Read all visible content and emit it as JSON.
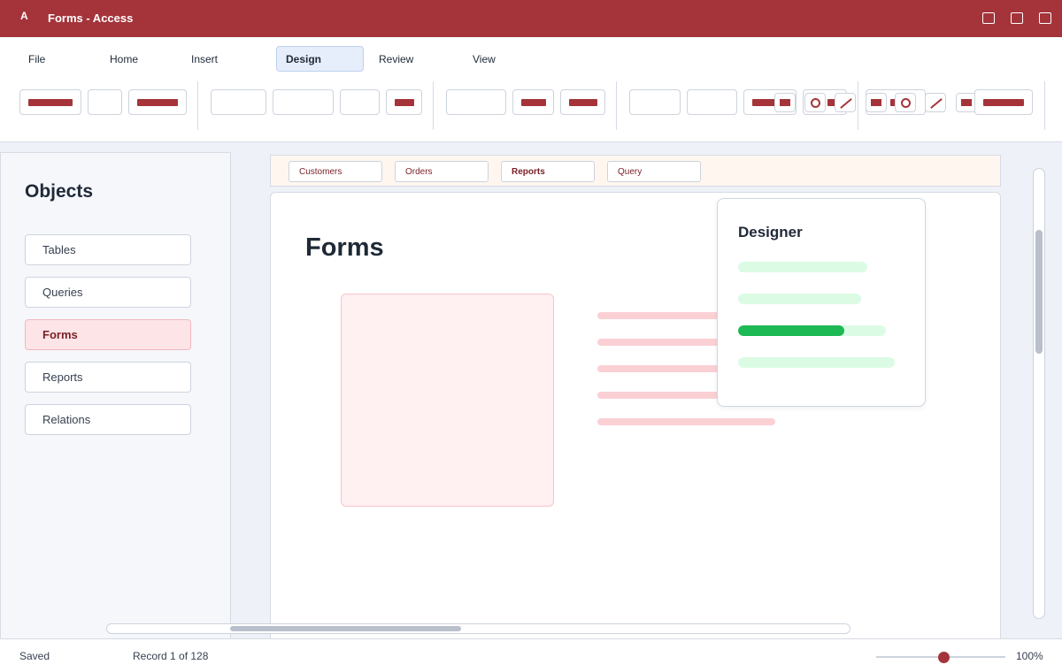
{
  "app": {
    "logo": "A",
    "title": "Forms - Access"
  },
  "ribbon": {
    "tabs": [
      {
        "label": "File"
      },
      {
        "label": "Home"
      },
      {
        "label": "Insert"
      },
      {
        "label": "Design",
        "active": true
      },
      {
        "label": "Review"
      },
      {
        "label": "View"
      }
    ],
    "icons": [
      "square-bar-icon",
      "circle-icon",
      "line-icon"
    ]
  },
  "sidebar": {
    "title": "Objects",
    "items": [
      {
        "label": "Tables"
      },
      {
        "label": "Queries"
      },
      {
        "label": "Forms",
        "active": true
      },
      {
        "label": "Reports"
      },
      {
        "label": "Relations"
      }
    ]
  },
  "doc_tabs": [
    {
      "label": "Customers"
    },
    {
      "label": "Orders"
    },
    {
      "label": "Reports",
      "active": true
    },
    {
      "label": "Query"
    }
  ],
  "canvas": {
    "title": "Forms"
  },
  "designer": {
    "title": "Designer",
    "progress": 0.72
  },
  "status": {
    "saved": "Saved",
    "record": "Record 1 of 128",
    "zoom": "100%",
    "zoom_slider": 0.5
  },
  "colors": {
    "accent": "#a4343a",
    "progress": "#1db954",
    "active_tab_bg": "#e7eefb"
  }
}
